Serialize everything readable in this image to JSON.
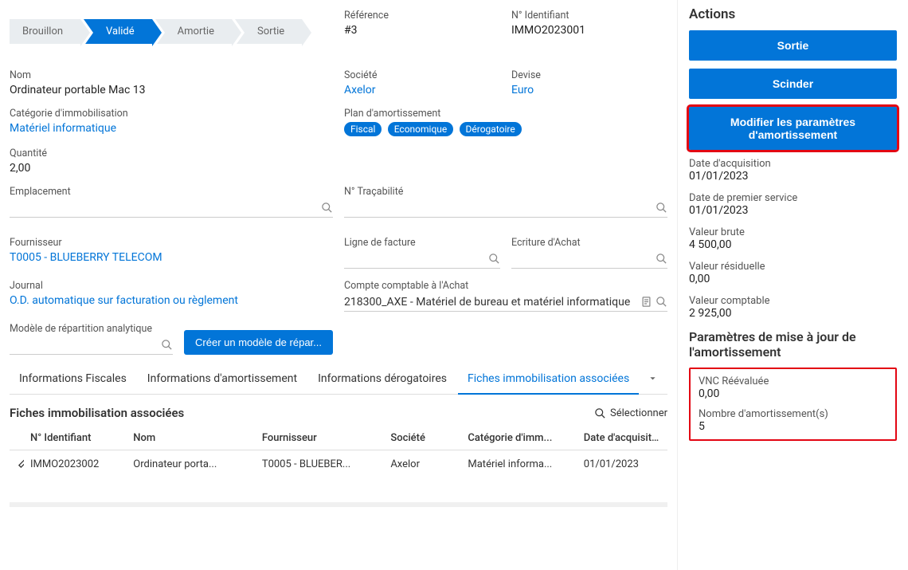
{
  "status_steps": {
    "draft": "Brouillon",
    "validated": "Validé",
    "amortized": "Amortie",
    "out": "Sortie"
  },
  "header": {
    "reference_label": "Référence",
    "reference_value": "#3",
    "identifier_label": "N° Identifiant",
    "identifier_value": "IMMO2023001"
  },
  "left": {
    "name_label": "Nom",
    "name_value": "Ordinateur portable Mac 13",
    "category_label": "Catégorie d'immobilisation",
    "category_value": "Matériel informatique",
    "qty_label": "Quantité",
    "qty_value": "2,00",
    "location_label": "Emplacement",
    "supplier_label": "Fournisseur",
    "supplier_value": "T0005 - BLUEBERRY TELECOM",
    "journal_label": "Journal",
    "journal_value": "O.D. automatique sur facturation ou règlement",
    "analytic_label": "Modèle de répartition analytique",
    "create_model_btn": "Créer un modèle de répar..."
  },
  "right": {
    "company_label": "Société",
    "company_value": "Axelor",
    "currency_label": "Devise",
    "currency_value": "Euro",
    "plan_label": "Plan d'amortissement",
    "plan_badges": [
      "Fiscal",
      "Economique",
      "Dérogatoire"
    ],
    "trace_label": "N° Traçabilité",
    "invoice_line_label": "Ligne de facture",
    "purchase_entry_label": "Ecriture d'Achat",
    "purchase_account_label": "Compte comptable à l'Achat",
    "purchase_account_value": "218300_AXE - Matériel de bureau et matériel informatique"
  },
  "tabs": {
    "fiscal": "Informations Fiscales",
    "amort": "Informations d'amortissement",
    "derog": "Informations dérogatoires",
    "assoc": "Fiches immobilisation associées"
  },
  "assoc": {
    "title": "Fiches immobilisation associées",
    "select": "Sélectionner",
    "columns": {
      "id": "N° Identifiant",
      "name": "Nom",
      "supplier": "Fournisseur",
      "company": "Société",
      "category": "Catégorie d'imm...",
      "acq_date": "Date d'acquisitio..."
    },
    "rows": [
      {
        "id": "IMMO2023002",
        "name": "Ordinateur porta...",
        "supplier": "T0005 - BLUEBER...",
        "company": "Axelor",
        "category": "Matériel informa...",
        "acq_date": "01/01/2023"
      }
    ]
  },
  "actions": {
    "title": "Actions",
    "sortie": "Sortie",
    "scinder": "Scinder",
    "modifier": "Modifier les paramètres d'amortissement",
    "acq_date_label": "Date d'acquisition",
    "acq_date": "01/01/2023",
    "service_date_label": "Date de premier service",
    "service_date": "01/01/2023",
    "gross_label": "Valeur brute",
    "gross": "4 500,00",
    "residual_label": "Valeur résiduelle",
    "residual": "0,00",
    "book_label": "Valeur comptable",
    "book": "2 925,00",
    "update_params_title": "Paramètres de mise à jour de l'amortissement",
    "vnc_label": "VNC Réévaluée",
    "vnc": "0,00",
    "nb_label": "Nombre d'amortissement(s)",
    "nb": "5"
  }
}
